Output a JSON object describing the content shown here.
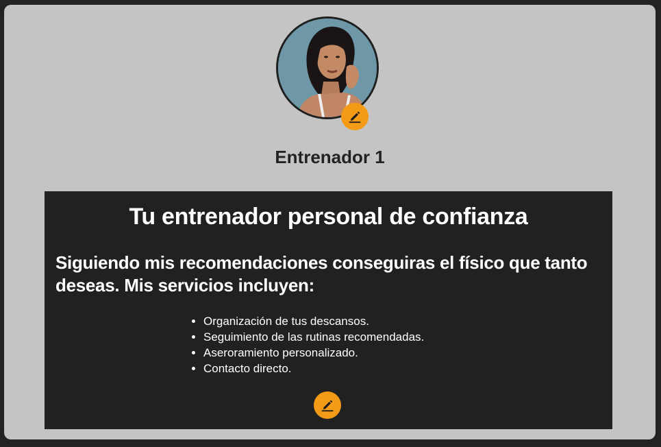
{
  "profile": {
    "avatar_alt": "Entrenador 1",
    "name": "Entrenador 1",
    "avatar_edit_icon": "pencil-icon",
    "accent_color": "#f39a16"
  },
  "panel": {
    "title": "Tu entrenador personal de confianza",
    "subtitle": "Siguiendo mis recomendaciones conseguiras el físico que tanto deseas. Mis servicios incluyen:",
    "services": [
      "Organización de tus descansos.",
      "Seguimiento de las rutinas recomendadas.",
      "Aseroramiento personalizado.",
      "Contacto directo."
    ],
    "edit_icon": "pencil-icon"
  },
  "colors": {
    "background": "#232323",
    "card": "#c4c4c4",
    "panel": "#212121",
    "accent": "#f39a16"
  }
}
